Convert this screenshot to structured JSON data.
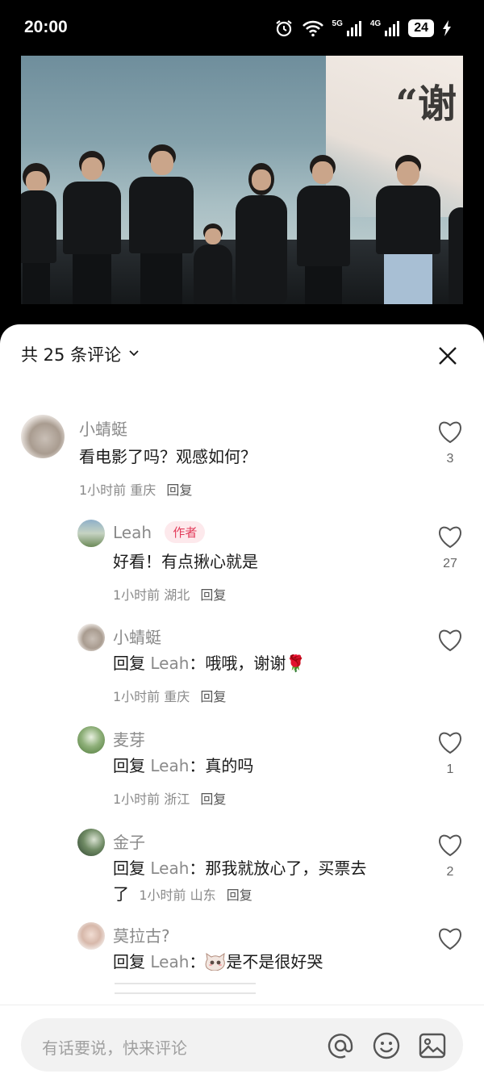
{
  "status_bar": {
    "time": "20:00",
    "network_1": "5G",
    "network_2": "4G",
    "battery": "24",
    "icons": [
      "alarm-icon",
      "wifi-icon",
      "signal-icon",
      "signal-icon",
      "battery-icon",
      "charging-icon"
    ]
  },
  "video": {
    "screen_text": "“谢"
  },
  "comments_panel": {
    "title": "共 25 条评论",
    "comments": [
      {
        "name": "小蜻蜓",
        "text": "看电影了吗？观感如何？",
        "time": "1小时前",
        "location": "重庆",
        "reply_label": "回复",
        "likes": "3"
      },
      {
        "name": "Leah",
        "badge": "作者",
        "text": "好看！有点揪心就是",
        "time": "1小时前",
        "location": "湖北",
        "reply_label": "回复",
        "likes": "27"
      },
      {
        "name": "小蜻蜓",
        "reply_prefix": "回复",
        "reply_to": "Leah",
        "separator": "：",
        "text": "哦哦，谢谢🌹",
        "time": "1小时前",
        "location": "重庆",
        "reply_label": "回复",
        "likes": ""
      },
      {
        "name": "麦芽",
        "reply_prefix": "回复",
        "reply_to": "Leah",
        "separator": "：",
        "text": "真的吗",
        "time": "1小时前",
        "location": "浙江",
        "reply_label": "回复",
        "likes": "1"
      },
      {
        "name": "金子",
        "reply_prefix": "回复",
        "reply_to": "Leah",
        "separator": "：",
        "text_line1": "那我就放心了，买票去",
        "text_line2": "了",
        "time": "1小时前",
        "location": "山东",
        "reply_label": "回复",
        "likes": "2"
      },
      {
        "name": "莫拉古?",
        "reply_prefix": "回复",
        "reply_to": "Leah",
        "separator": "：",
        "text": "是不是很好哭",
        "likes": ""
      }
    ]
  },
  "input": {
    "placeholder": "有话要说，快来评论"
  },
  "colors": {
    "author_badge_bg": "#fde9ec",
    "author_badge_text": "#e23b5a",
    "secondary_text": "#8a8a8a"
  }
}
